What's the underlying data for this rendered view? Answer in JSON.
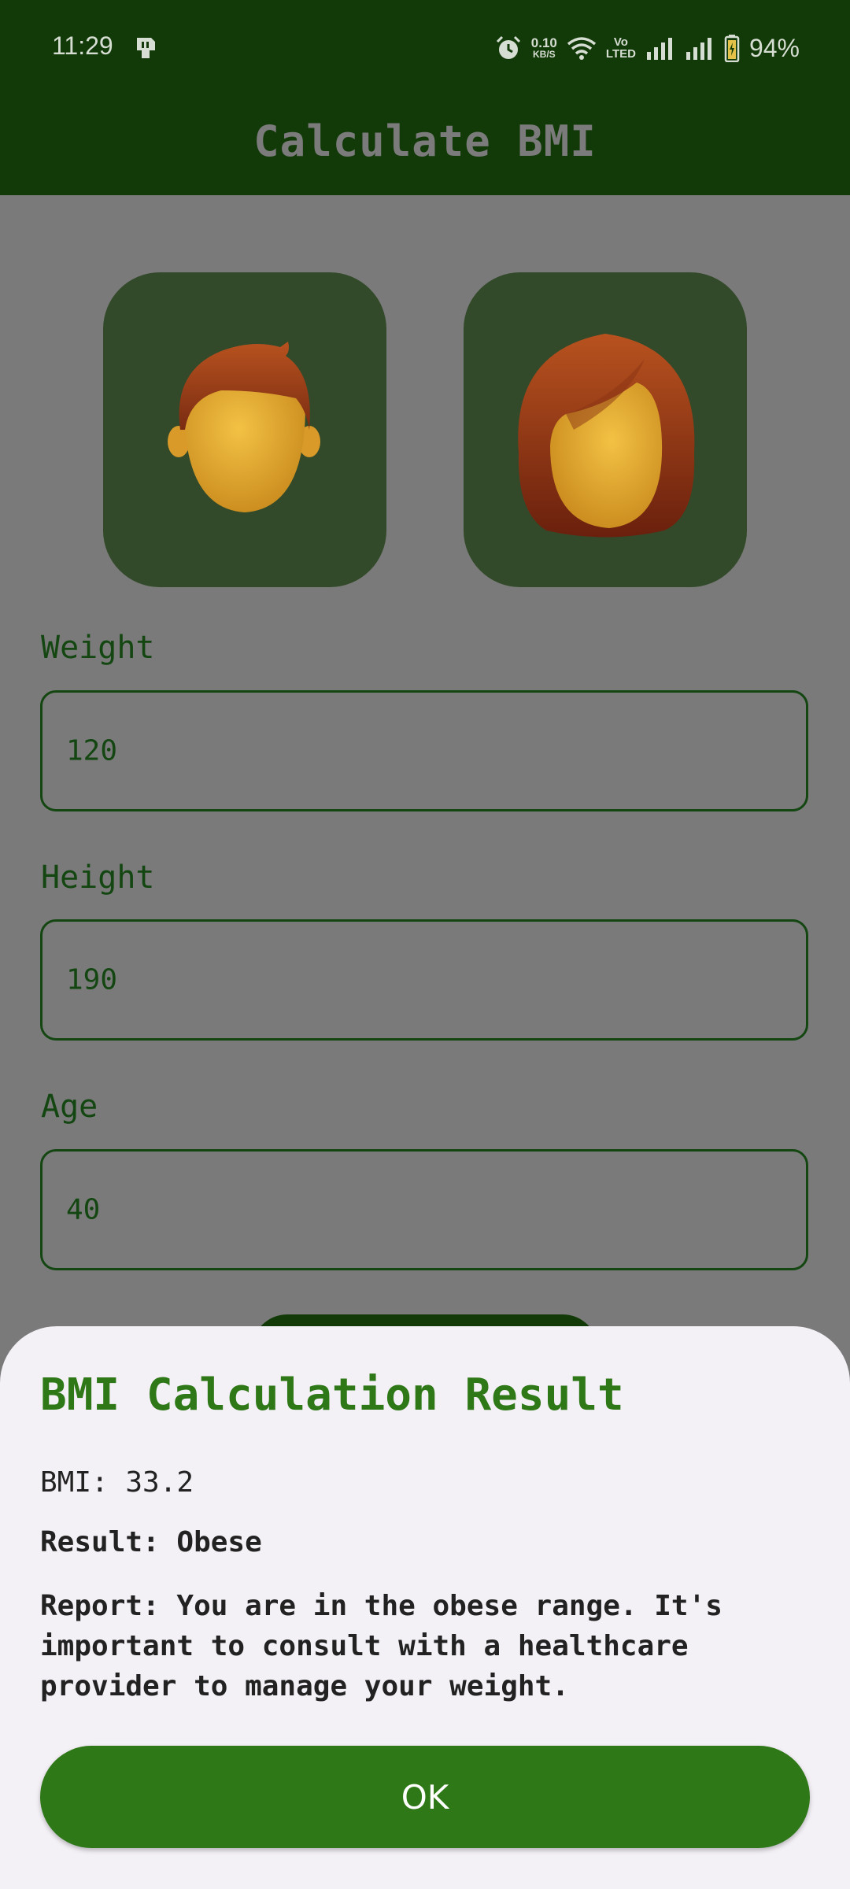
{
  "status_bar": {
    "time": "11:29",
    "net_speed_value": "0.10",
    "net_speed_unit": "KB/S",
    "volte_top": "Vo",
    "volte_bottom": "LTED",
    "battery": "94%",
    "icons": [
      "sim-card-icon",
      "alarm-icon",
      "wifi-icon",
      "signal-icon",
      "battery-icon"
    ]
  },
  "app_bar": {
    "title": "Calculate BMI"
  },
  "gender": {
    "male_icon": "male-face-icon",
    "female_icon": "female-face-icon"
  },
  "form": {
    "weight": {
      "label": "Weight",
      "value": "120"
    },
    "height": {
      "label": "Height",
      "value": "190"
    },
    "age": {
      "label": "Age",
      "value": "40"
    }
  },
  "sheet": {
    "title": "BMI Calculation Result",
    "bmi_text": "BMI: 33.2",
    "result_text": "Result: Obese",
    "report_text": "Report: You are in the obese range. It's important to consult with a healthcare provider to manage your weight.",
    "ok_label": "OK"
  },
  "colors": {
    "app_bar": "#123a08",
    "accent": "#2e7817",
    "field_text": "#134611",
    "tile": "#324a29",
    "sheet_bg": "#f3f0f6"
  }
}
